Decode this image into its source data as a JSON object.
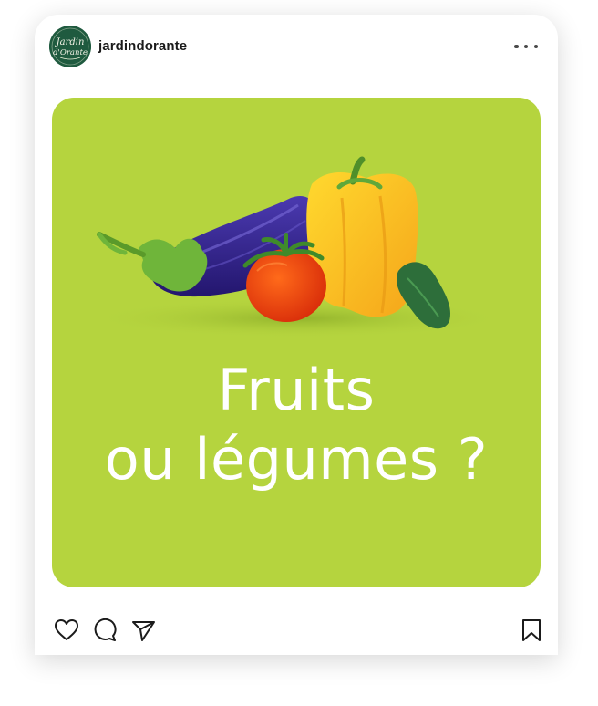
{
  "profile": {
    "username": "jardindorante",
    "avatar_text_top": "Jardin",
    "avatar_text_bottom": "d'Orante"
  },
  "post": {
    "background_color": "#b5d43e",
    "headline_line1": "Fruits",
    "headline_line2": "ou légumes ?",
    "illustration": [
      "eggplant",
      "tomato",
      "yellow-pepper",
      "cucumber"
    ]
  },
  "actions": {
    "like_icon": "heart-icon",
    "comment_icon": "comment-icon",
    "share_icon": "send-icon",
    "save_icon": "bookmark-icon",
    "more_icon": "more-horizontal-icon"
  }
}
